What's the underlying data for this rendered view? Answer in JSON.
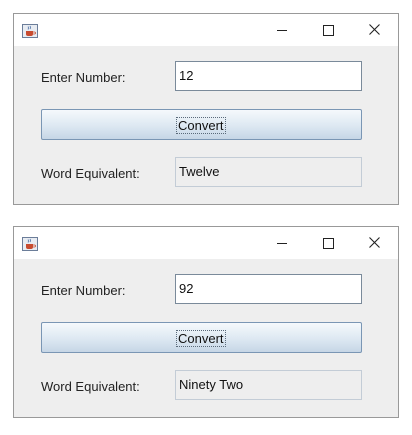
{
  "windows": [
    {
      "number_label": "Enter Number:",
      "number_value": "12",
      "convert_label": "Convert",
      "word_label": "Word Equivalent:",
      "word_value": "Twelve"
    },
    {
      "number_label": "Enter Number:",
      "number_value": "92",
      "convert_label": "Convert",
      "word_label": "Word Equivalent:",
      "word_value": "Ninety Two"
    }
  ],
  "icons": {
    "app": "java-coffee-cup-icon",
    "minimize": "minimize-icon",
    "maximize": "maximize-icon",
    "close": "close-icon"
  },
  "colors": {
    "window_bg": "#eeeeee",
    "titlebar_bg": "#ffffff",
    "button_gradient_top": "#f5f9fc",
    "button_gradient_bottom": "#c6d6e6"
  }
}
